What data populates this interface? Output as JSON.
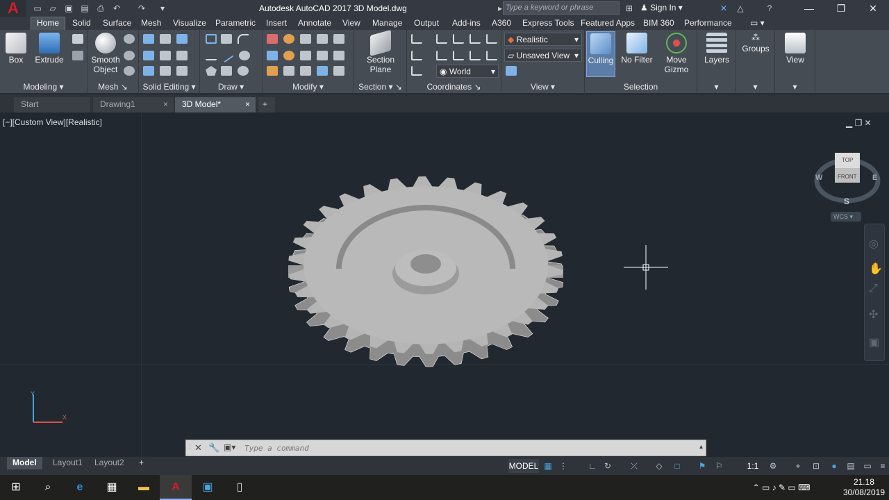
{
  "title": {
    "app_logo": "A",
    "text": "Autodesk AutoCAD 2017    3D Model.dwg"
  },
  "search": {
    "placeholder": "Type a keyword or phrase"
  },
  "account": {
    "signin": "Sign In"
  },
  "ribbon_tabs": [
    "Home",
    "Solid",
    "Surface",
    "Mesh",
    "Visualize",
    "Parametric",
    "Insert",
    "Annotate",
    "View",
    "Manage",
    "Output",
    "Add-ins",
    "A360",
    "Express Tools",
    "Featured Apps",
    "BIM 360",
    "Performance"
  ],
  "panels": {
    "modeling": {
      "title": "Modeling",
      "box": "Box",
      "extrude": "Extrude"
    },
    "mesh": {
      "title": "Mesh",
      "smooth": "Smooth",
      "object": "Object"
    },
    "solid_editing": {
      "title": "Solid Editing"
    },
    "draw": {
      "title": "Draw"
    },
    "modify": {
      "title": "Modify"
    },
    "section": {
      "title": "Section",
      "plane1": "Section",
      "plane2": "Plane"
    },
    "coordinates": {
      "title": "Coordinates",
      "world": "World"
    },
    "view": {
      "title": "View",
      "visual_style": "Realistic",
      "saved_view": "Unsaved View"
    },
    "selection": {
      "title": "Selection",
      "culling": "Culling",
      "nofilter": "No Filter",
      "move1": "Move",
      "move2": "Gizmo"
    },
    "layers": "Layers",
    "groups": "Groups",
    "viewpanel": "View"
  },
  "doc_tabs": [
    "Start",
    "Drawing1",
    "3D Model*"
  ],
  "viewport": {
    "label": "[−][Custom View][Realistic]"
  },
  "viewcube": {
    "top": "TOP",
    "front": "FRONT",
    "w": "W",
    "e": "E",
    "s": "S",
    "wcs": "WCS"
  },
  "command": {
    "placeholder": "Type a command"
  },
  "layout_tabs": [
    "Model",
    "Layout1",
    "Layout2"
  ],
  "status": {
    "model": "MODEL",
    "scale": "1:1"
  },
  "clock": {
    "time": "21.18",
    "date": "30/08/2019"
  },
  "colors": {
    "accent": "#d41f26",
    "ribbon": "#464c54",
    "viewport": "#212830",
    "gear": "#b5b5b5"
  }
}
